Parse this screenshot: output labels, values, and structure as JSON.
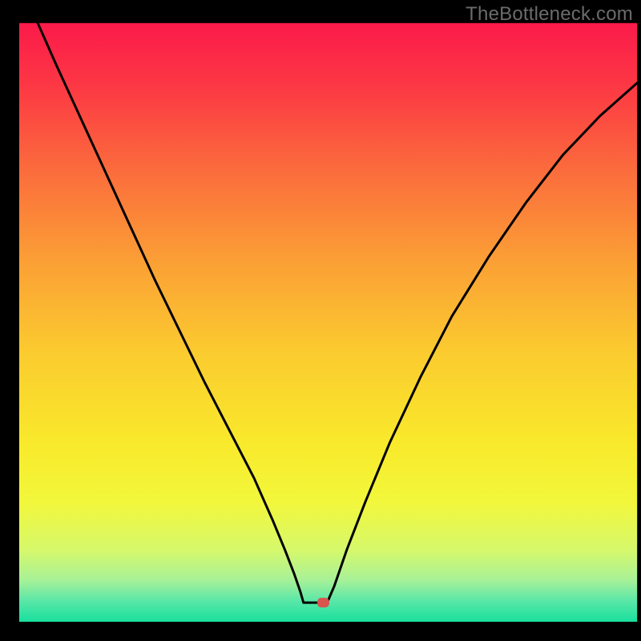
{
  "watermark": "TheBottleneck.com",
  "chart_data": {
    "type": "line",
    "title": "",
    "xlabel": "",
    "ylabel": "",
    "xlim": [
      0,
      100
    ],
    "ylim": [
      0,
      100
    ],
    "series": [
      {
        "name": "curve",
        "x": [
          3,
          6,
          10,
          14,
          18,
          22,
          26,
          30,
          34,
          38,
          41,
          43,
          44.5,
          45.5,
          46,
          49,
          49.5,
          50,
          51,
          53,
          56,
          60,
          65,
          70,
          76,
          82,
          88,
          94,
          100
        ],
        "y": [
          100,
          93,
          84,
          75,
          66,
          57,
          48.5,
          40,
          32,
          24,
          17,
          12,
          8,
          5,
          3.2,
          3.2,
          3.2,
          3.6,
          6,
          12,
          20,
          30,
          41,
          51,
          61,
          70,
          78,
          84.5,
          90
        ]
      }
    ],
    "marker": {
      "x": 49.2,
      "y": 3.2
    },
    "gradient_stops": [
      {
        "offset": 0.0,
        "color": "#fb1a4a"
      },
      {
        "offset": 0.1,
        "color": "#fc3644"
      },
      {
        "offset": 0.25,
        "color": "#fb6d3c"
      },
      {
        "offset": 0.4,
        "color": "#fba035"
      },
      {
        "offset": 0.55,
        "color": "#fbcb2f"
      },
      {
        "offset": 0.7,
        "color": "#f9e92b"
      },
      {
        "offset": 0.8,
        "color": "#f2f73b"
      },
      {
        "offset": 0.88,
        "color": "#d6f86b"
      },
      {
        "offset": 0.93,
        "color": "#a8f197"
      },
      {
        "offset": 0.965,
        "color": "#5ae7a8"
      },
      {
        "offset": 1.0,
        "color": "#18df9d"
      }
    ],
    "frame_inset": {
      "left": 3.0,
      "right": 0.6,
      "top": 3.6,
      "bottom": 3.0
    }
  }
}
